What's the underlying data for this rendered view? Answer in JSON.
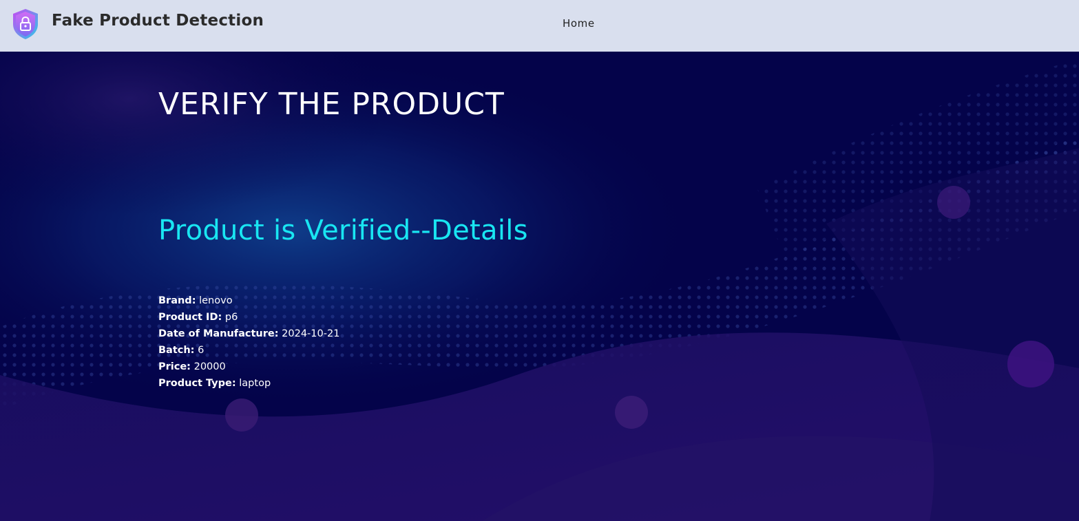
{
  "navbar": {
    "title": "Fake Product Detection",
    "logo_icon": "shield-lock-icon",
    "links": [
      {
        "label": "Home"
      }
    ]
  },
  "main": {
    "heading": "VERIFY THE PRODUCT",
    "status": "Product is Verified--Details",
    "details": [
      {
        "label": "Brand:",
        "value": "lenovo"
      },
      {
        "label": "Product ID:",
        "value": "p6"
      },
      {
        "label": "Date of Manufacture:",
        "value": "2024-10-21"
      },
      {
        "label": "Batch:",
        "value": "6"
      },
      {
        "label": "Price:",
        "value": "20000"
      },
      {
        "label": "Product Type:",
        "value": "laptop"
      }
    ]
  },
  "colors": {
    "navbar_bg": "#d9dfee",
    "page_bg": "#04034a",
    "heading": "#ffffff",
    "status": "#19e6f2"
  }
}
